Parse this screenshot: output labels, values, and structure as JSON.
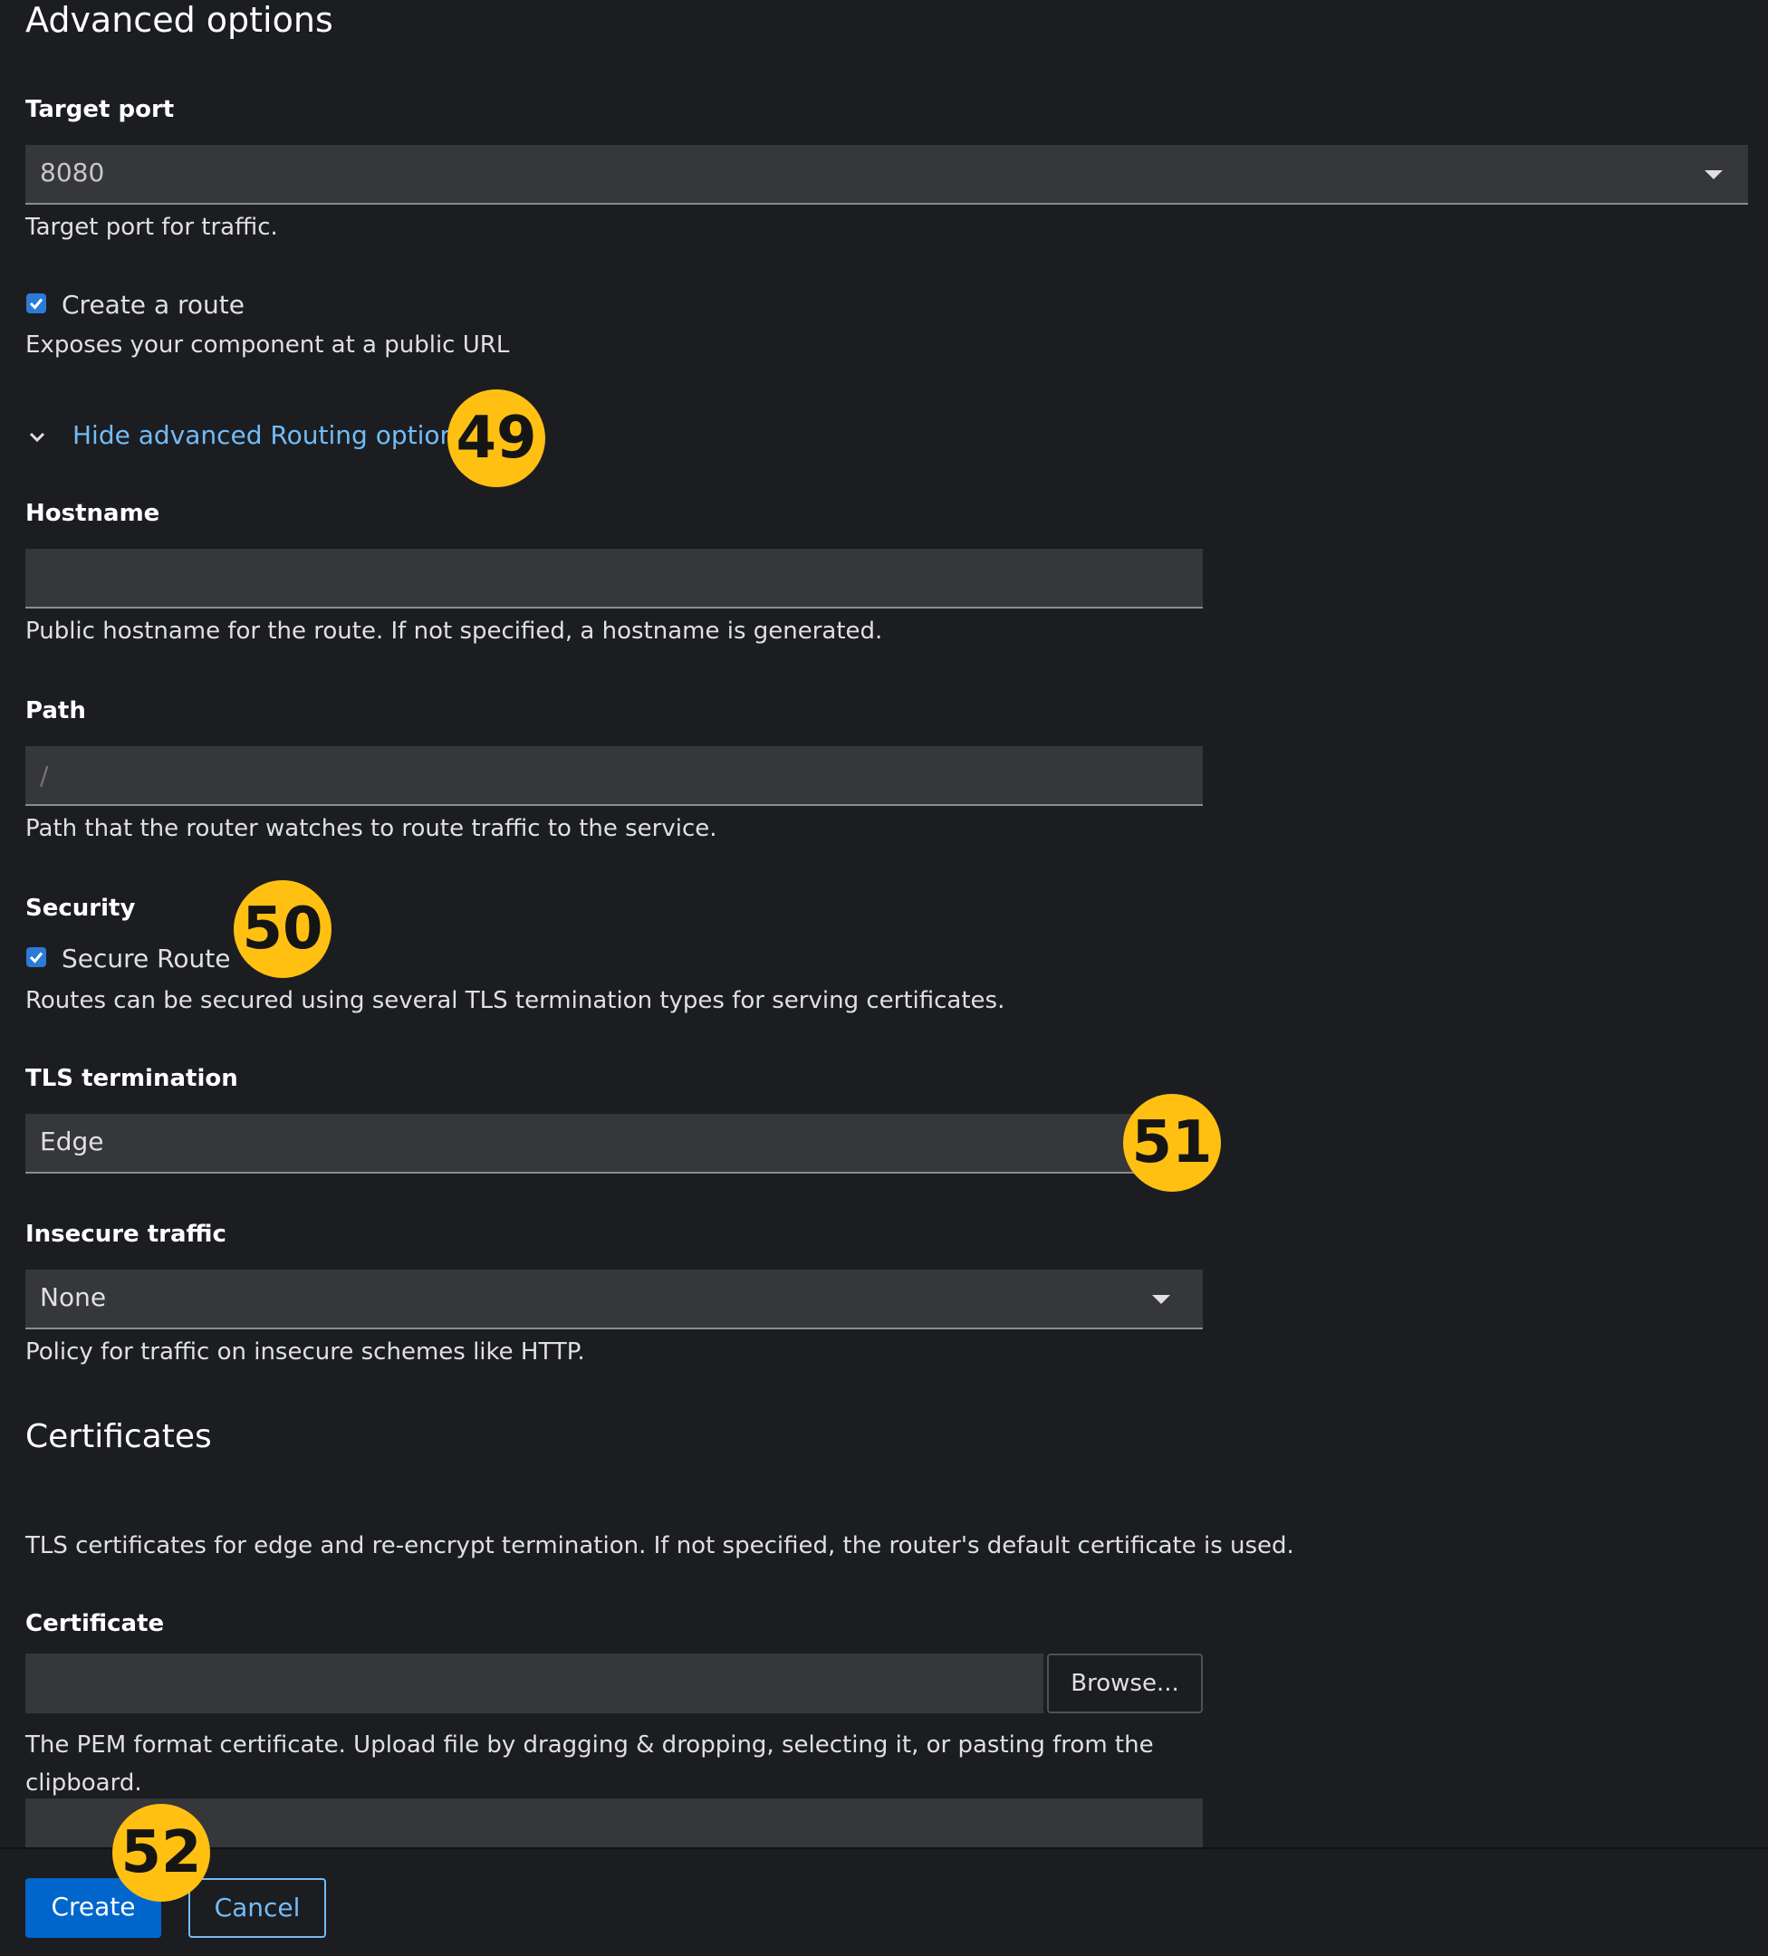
{
  "section": {
    "title": "Advanced options"
  },
  "target_port": {
    "label": "Target port",
    "value": "8080",
    "help": "Target port for traffic."
  },
  "create_route": {
    "label": "Create a route",
    "checked": true,
    "help": "Exposes your component at a public URL"
  },
  "routing_toggle": {
    "label": "Hide advanced Routing options"
  },
  "hostname": {
    "label": "Hostname",
    "value": "",
    "help": "Public hostname for the route. If not specified, a hostname is generated."
  },
  "path": {
    "label": "Path",
    "placeholder": "/",
    "help": "Path that the router watches to route traffic to the service."
  },
  "security": {
    "label": "Security",
    "secure_route_label": "Secure Route",
    "checked": true,
    "help": "Routes can be secured using several TLS termination types for serving certificates."
  },
  "tls_termination": {
    "label": "TLS termination",
    "value": "Edge"
  },
  "insecure_traffic": {
    "label": "Insecure traffic",
    "value": "None",
    "help": "Policy for traffic on insecure schemes like HTTP."
  },
  "certificates": {
    "title": "Certificates",
    "help": "TLS certificates for edge and re-encrypt termination. If not specified, the router's default certificate is used."
  },
  "certificate": {
    "label": "Certificate",
    "browse_label": "Browse...",
    "help": "The PEM format certificate. Upload file by dragging & dropping, selecting it, or pasting from the clipboard."
  },
  "footer": {
    "create_label": "Create",
    "cancel_label": "Cancel"
  },
  "annotations": {
    "badge_49": "49",
    "badge_50": "50",
    "badge_51": "51",
    "badge_52": "52"
  },
  "colors": {
    "background": "#1b1d21",
    "field": "#36373b",
    "link": "#73bcf7",
    "primary": "#0066cc",
    "badge": "#ffc012"
  }
}
